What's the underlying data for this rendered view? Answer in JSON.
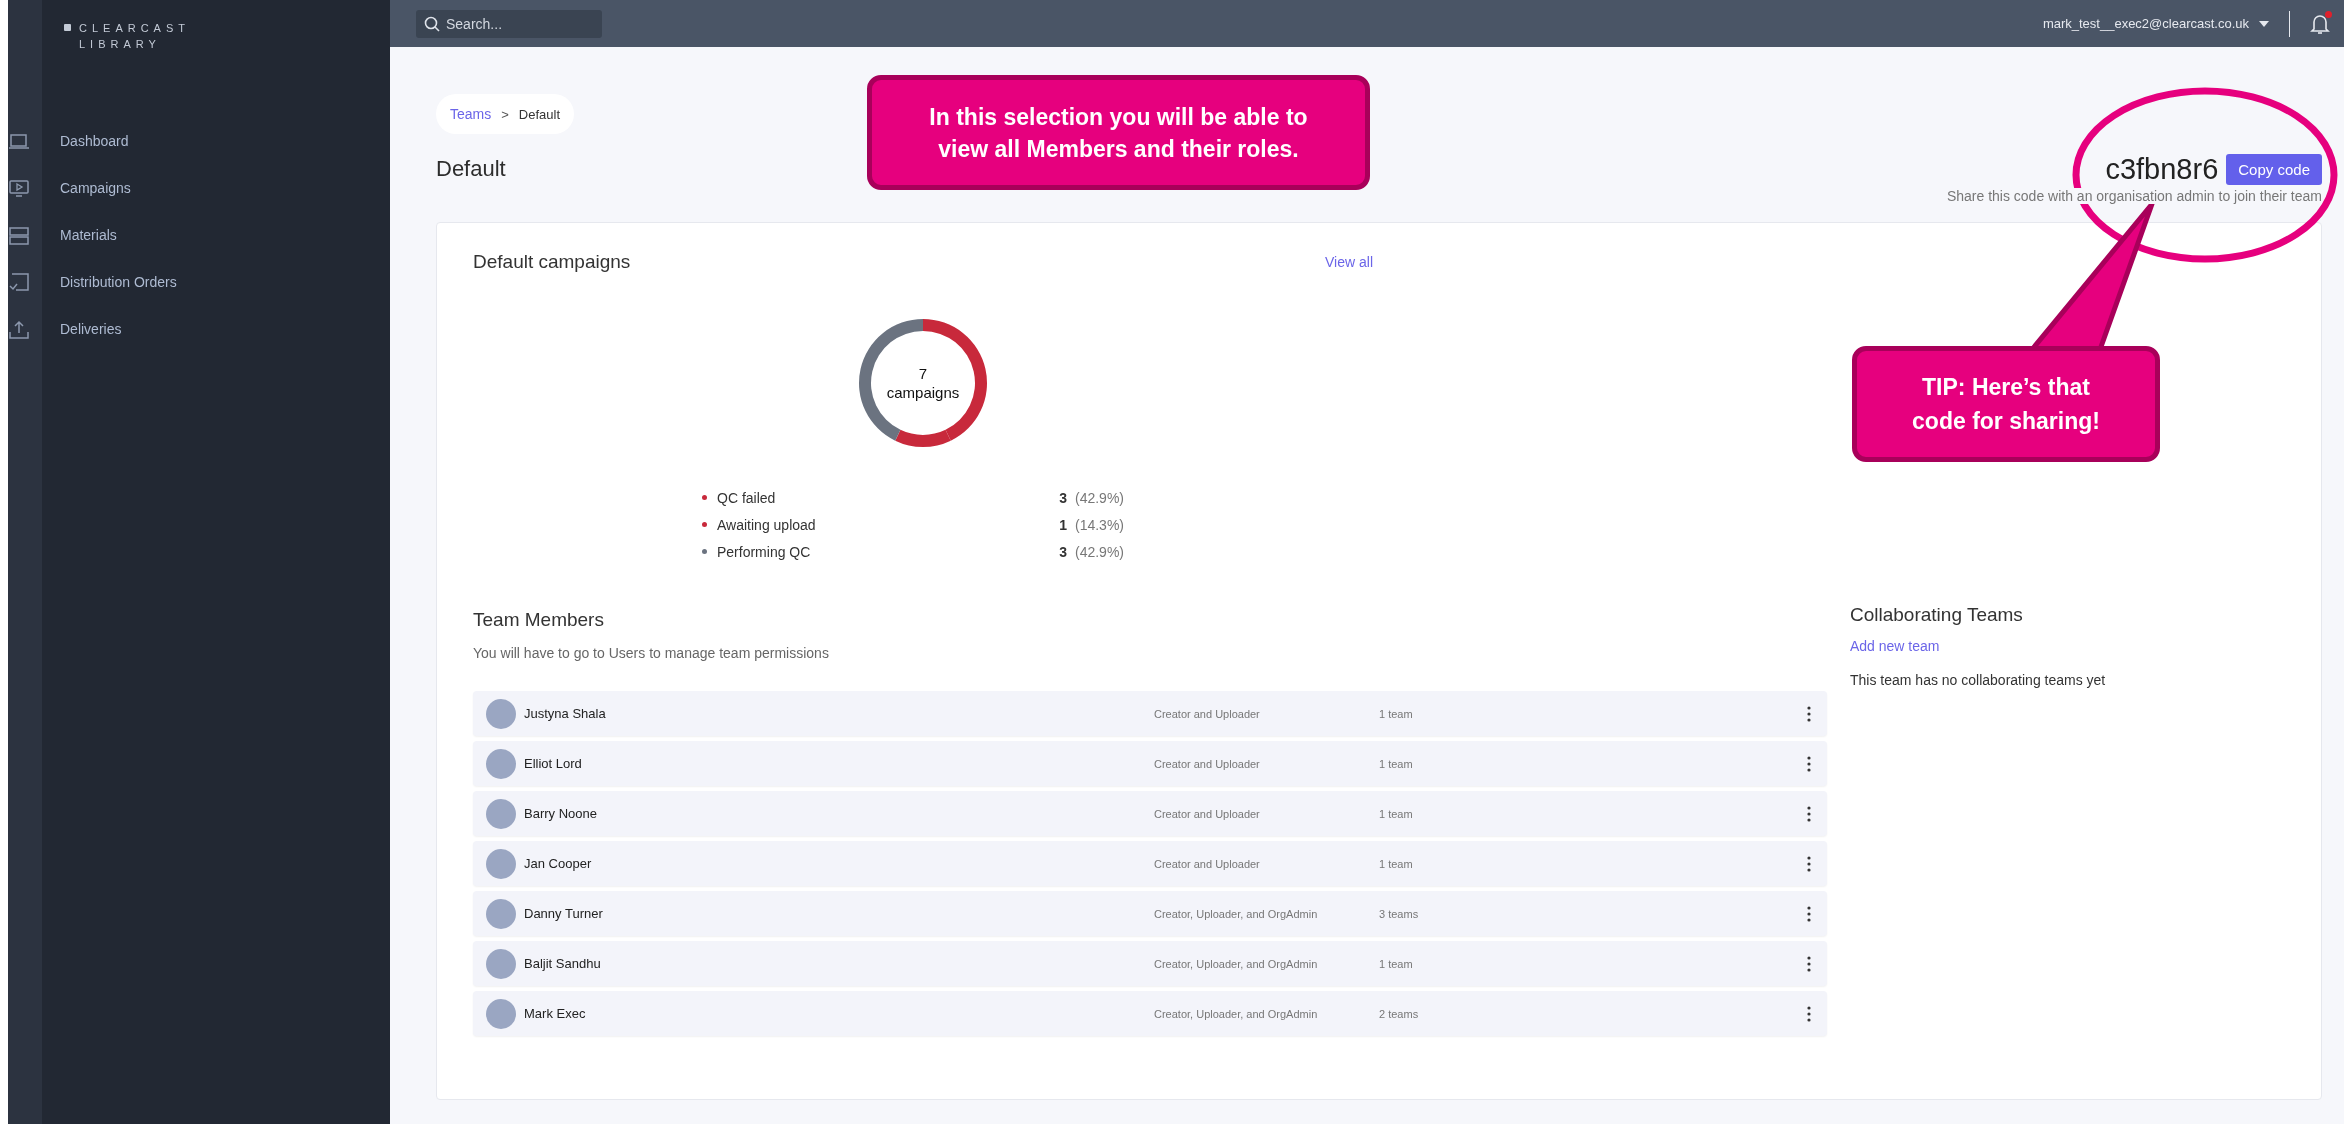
{
  "brand": {
    "line_1": "CLEARCAST",
    "line_2": "LIBRARY"
  },
  "sidebar": {
    "items": [
      {
        "label": "Dashboard"
      },
      {
        "label": "Campaigns"
      },
      {
        "label": "Materials"
      },
      {
        "label": "Distribution Orders"
      },
      {
        "label": "Deliveries"
      }
    ]
  },
  "top_bar": {
    "search": {
      "placeholder": "Search..."
    },
    "user": "mark_test__exec2@clearcast.co.uk",
    "has_notifications": true
  },
  "breadcrumb": [
    {
      "label": "Teams",
      "link": true
    },
    {
      "label": "Default",
      "link": false
    }
  ],
  "breadcrumb_separator": ">",
  "page_title": "Default",
  "team_code": {
    "code": "c3fbn8r6",
    "button": "Copy code",
    "hint": "Share this code with an organisation admin to join their team"
  },
  "campaigns": {
    "title": "Default campaigns",
    "view_all": "View all",
    "center_count": "7",
    "chart_data": {
      "type": "donut",
      "categories": [
        "QC failed",
        "Awaiting upload",
        "Performing QC"
      ],
      "series": [
        {
          "name": "campaigns",
          "values": [
            42.9,
            14.3,
            42.9
          ]
        }
      ]
    },
    "legend": [
      {
        "count": "3",
        "percent": "(42.9%)",
        "color": "#c8293b"
      },
      {
        "count": "1",
        "percent": "(14.3%)",
        "color": "#c8293b"
      },
      {
        "count": "3",
        "percent": "(42.9%)",
        "color": "#6b7380"
      }
    ]
  },
  "team_members": {
    "title": "Team Members",
    "subtitle": "You will have to go to Users to manage team permissions",
    "rows": [
      {
        "name": "Justyna Shala",
        "role": "Creator and Uploader",
        "teams": "1 team"
      },
      {
        "name": "Elliot Lord",
        "role": "Creator and Uploader",
        "teams": "1 team"
      },
      {
        "name": "Barry Noone",
        "role": "Creator and Uploader",
        "teams": "1 team"
      },
      {
        "name": "Jan Cooper",
        "role": "Creator and Uploader",
        "teams": "1 team"
      },
      {
        "name": "Danny Turner",
        "role": "Creator, Uploader, and OrgAdmin",
        "teams": "3 teams"
      },
      {
        "name": "Baljit Sandhu",
        "role": "Creator, Uploader, and OrgAdmin",
        "teams": "1 team"
      },
      {
        "name": "Mark Exec",
        "role": "Creator, Uploader, and OrgAdmin",
        "teams": "2 teams"
      }
    ]
  },
  "collaborating_teams": {
    "title": "Collaborating Teams",
    "add_link": "Add new team",
    "empty_text": "This team has no collaborating teams yet"
  },
  "annotations": [
    {
      "kind": "callout",
      "text": "In this selection you will be able to view all Members and their roles."
    },
    {
      "kind": "pointer_callout",
      "text": "TIP: Here’s that code for sharing!"
    }
  ]
}
